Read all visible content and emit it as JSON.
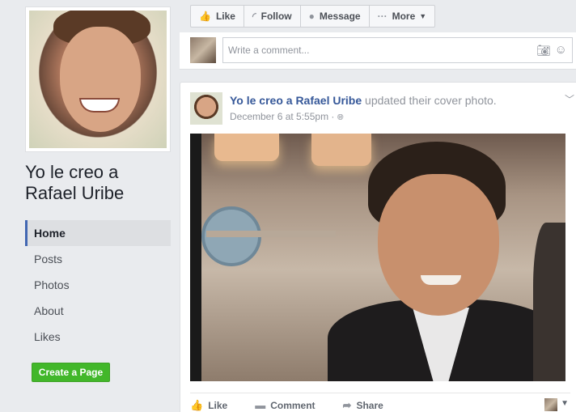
{
  "page": {
    "name": "Yo le creo a Rafael Uribe"
  },
  "nav": {
    "items": [
      {
        "label": "Home"
      },
      {
        "label": "Posts"
      },
      {
        "label": "Photos"
      },
      {
        "label": "About"
      },
      {
        "label": "Likes"
      }
    ],
    "create_page": "Create a Page"
  },
  "actions": {
    "like": "Like",
    "follow": "Follow",
    "message": "Message",
    "more": "More"
  },
  "comment_box": {
    "placeholder": "Write a comment..."
  },
  "post": {
    "author": "Yo le creo a Rafael Uribe",
    "action_text": " updated their cover photo.",
    "timestamp": "December 6 at 5:55pm",
    "privacy_separator": "·",
    "buttons": {
      "like": "Like",
      "comment": "Comment",
      "share": "Share"
    }
  },
  "colors": {
    "link": "#365899",
    "accent": "#4267b2",
    "create_button": "#42b72a"
  }
}
